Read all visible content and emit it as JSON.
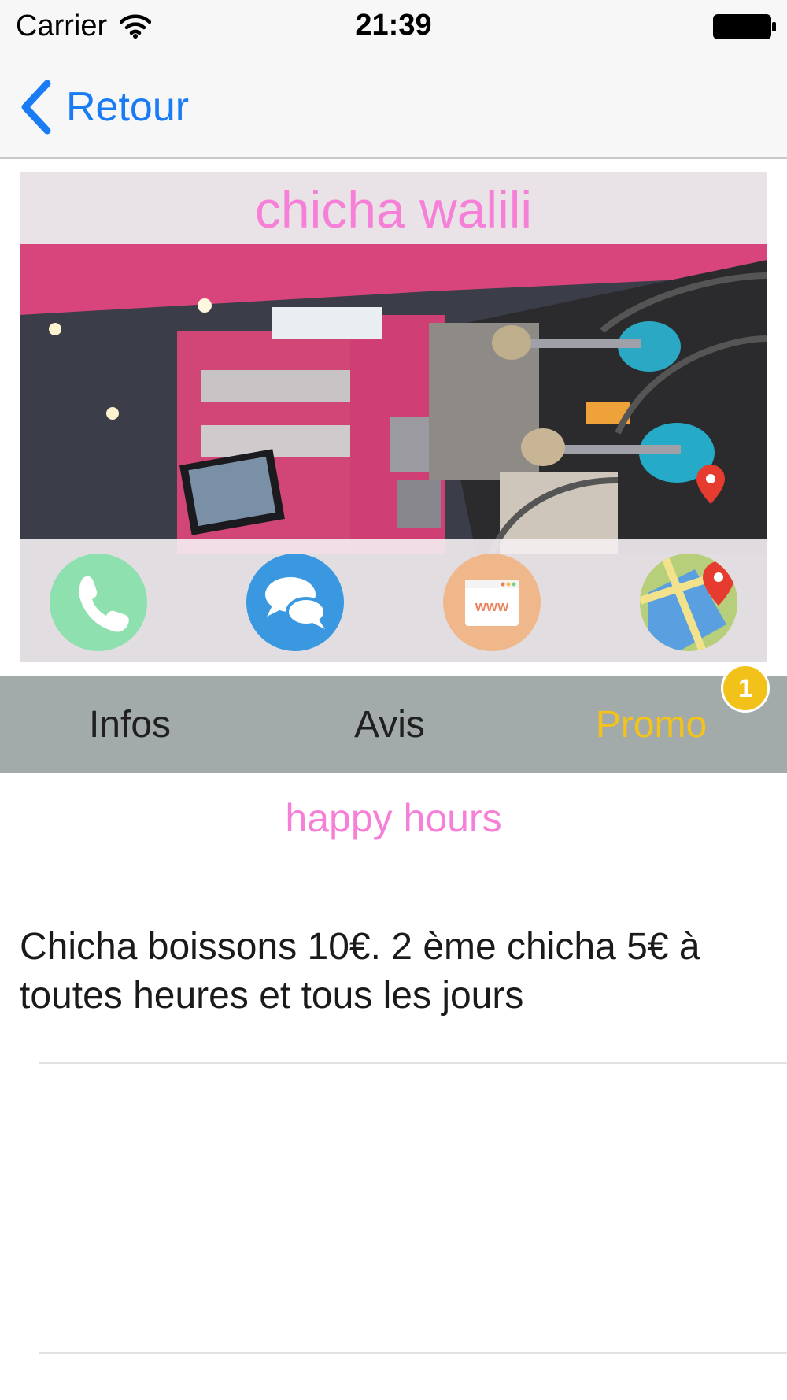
{
  "status_bar": {
    "carrier": "Carrier",
    "time": "21:39",
    "wifi_icon": "wifi-icon",
    "battery_icon": "battery-icon"
  },
  "nav": {
    "back_label": "Retour",
    "back_icon": "chevron-left-icon"
  },
  "venue": {
    "name": "chicha walili"
  },
  "actions": [
    {
      "name": "call",
      "icon": "phone-icon",
      "color": "#8ee0ae"
    },
    {
      "name": "message",
      "icon": "chat-bubbles-icon",
      "color": "#3a98e0"
    },
    {
      "name": "website",
      "icon": "browser-www-icon",
      "color": "#f0b88a"
    },
    {
      "name": "map",
      "icon": "map-pin-icon",
      "color": "#b7cf7a"
    }
  ],
  "web_icon_text": "WWW",
  "tabs": [
    {
      "label": "Infos",
      "active": false
    },
    {
      "label": "Avis",
      "active": false
    },
    {
      "label": "Promo",
      "active": true
    }
  ],
  "promo_badge": "1",
  "promo": {
    "title": "happy hours",
    "description": "Chicha   boissons 10€. 2 ème chicha 5€ à toutes heures et tous les jours"
  },
  "colors": {
    "accent_blue": "#1a7cf4",
    "title_pink": "#f67fd8",
    "active_tab_yellow": "#f3c21b",
    "tab_bar_gray": "#a2aaaa"
  }
}
